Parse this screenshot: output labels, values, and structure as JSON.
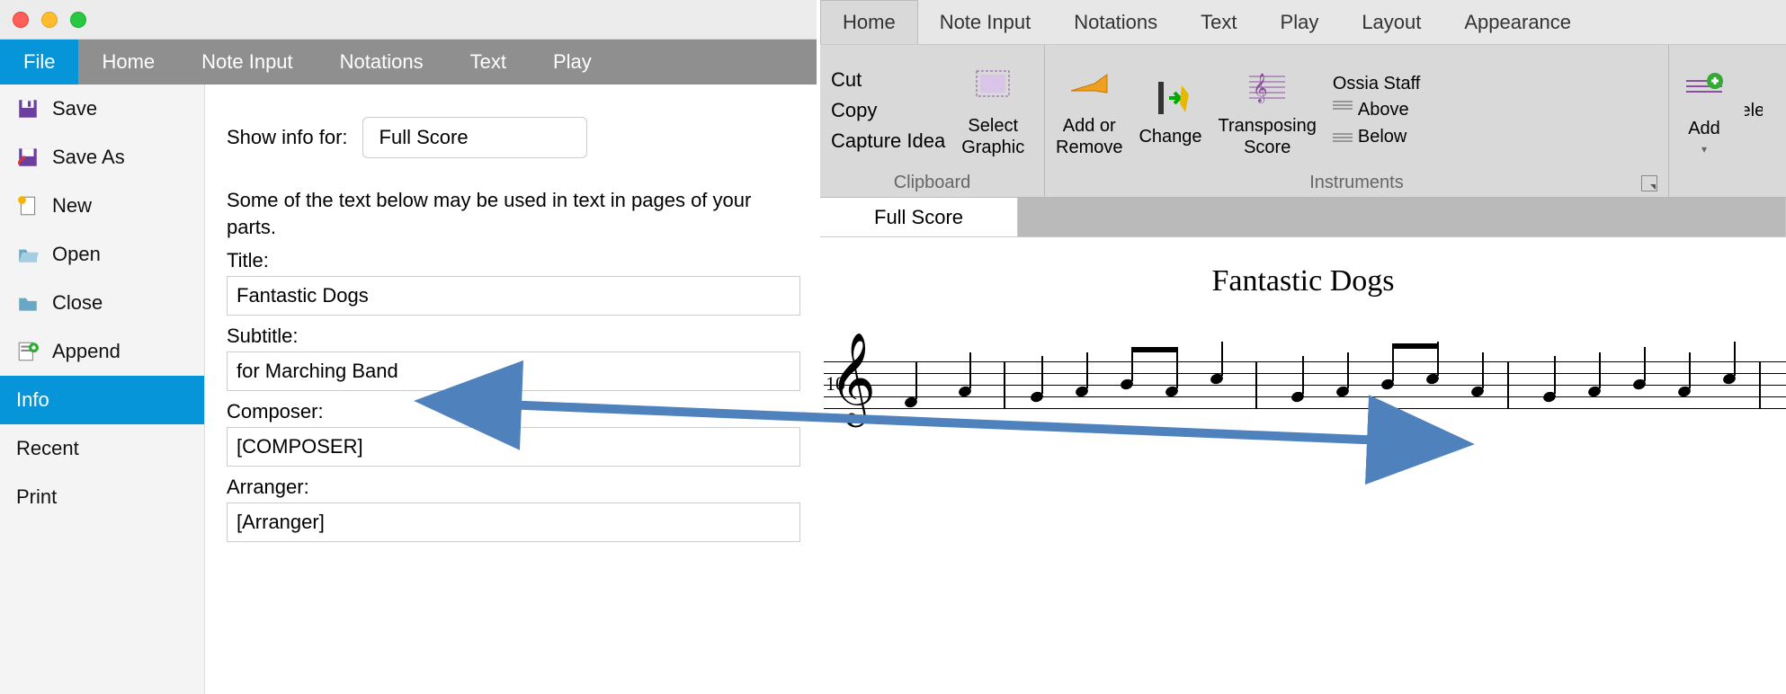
{
  "left": {
    "tabs": [
      "File",
      "Home",
      "Note Input",
      "Notations",
      "Text",
      "Play"
    ],
    "activeTab": "File",
    "sidebar": [
      {
        "label": "Save",
        "icon": "save"
      },
      {
        "label": "Save As",
        "icon": "saveas"
      },
      {
        "label": "New",
        "icon": "new"
      },
      {
        "label": "Open",
        "icon": "open"
      },
      {
        "label": "Close",
        "icon": "close"
      },
      {
        "label": "Append",
        "icon": "append"
      },
      {
        "label": "Info",
        "icon": "info",
        "active": true
      },
      {
        "label": "Recent",
        "icon": ""
      },
      {
        "label": "Print",
        "icon": ""
      }
    ],
    "info": {
      "showInfoLabel": "Show info for:",
      "showInfoValue": "Full Score",
      "desc": "Some of the text below may be used in text in pages of your parts.",
      "fields": {
        "titleLabel": "Title:",
        "titleValue": "Fantastic Dogs",
        "subtitleLabel": "Subtitle:",
        "subtitleValue": "for Marching Band",
        "composerLabel": "Composer:",
        "composerValue": "[COMPOSER]",
        "arrangerLabel": "Arranger:",
        "arrangerValue": "[Arranger]"
      }
    }
  },
  "right": {
    "tabs": [
      "Home",
      "Note Input",
      "Notations",
      "Text",
      "Play",
      "Layout",
      "Appearance"
    ],
    "activeTab": "Home",
    "ribbon": {
      "clipboard": {
        "title": "Clipboard",
        "items": [
          "Cut",
          "Copy",
          "Capture Idea"
        ],
        "select": "Select\nGraphic"
      },
      "instruments": {
        "title": "Instruments",
        "addRemove": "Add or\nRemove",
        "change": "Change",
        "transposing": "Transposing\nScore",
        "staffCol": [
          "Ossia Staff",
          "Above",
          "Below"
        ]
      },
      "bars": {
        "add": "Add",
        "delete": "Delete"
      }
    },
    "subtab": "Full Score",
    "score": {
      "title": "Fantastic Dogs",
      "measureNumber": "10"
    }
  }
}
